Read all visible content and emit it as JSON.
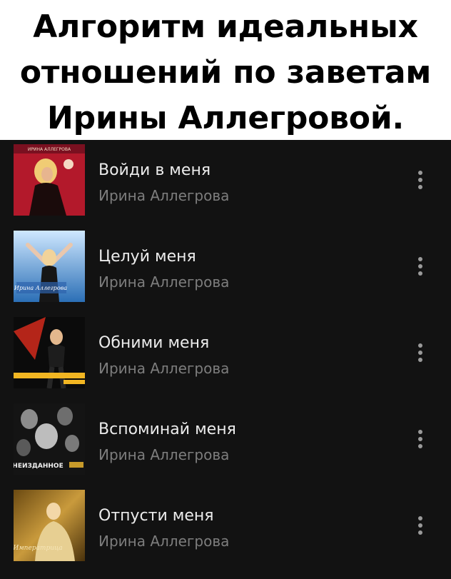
{
  "caption": {
    "line1": "Алгоритм идеальных",
    "line2": "отношений по заветам",
    "line3": "Ирины Аллегровой."
  },
  "tracks": [
    {
      "title": "Войди в меня",
      "artist": "Ирина Аллегрова",
      "cover_text": "ИРИНА АЛЛЕГРОВА"
    },
    {
      "title": "Целуй меня",
      "artist": "Ирина Аллегрова",
      "cover_text": "Ирина Аллегрова"
    },
    {
      "title": "Обними меня",
      "artist": "Ирина Аллегрова",
      "cover_text": ""
    },
    {
      "title": "Вспоминай меня",
      "artist": "Ирина Аллегрова",
      "cover_text": "НЕИЗДАННОЕ"
    },
    {
      "title": "Отпусти меня",
      "artist": "Ирина Аллегрова",
      "cover_text": "Императрица"
    }
  ],
  "colors": {
    "list_background": "#121212",
    "title_text": "#ececec",
    "artist_text": "#7d7d7d",
    "menu_dots": "#9a9a9a"
  },
  "icons": {
    "more": "more-vertical-icon"
  }
}
